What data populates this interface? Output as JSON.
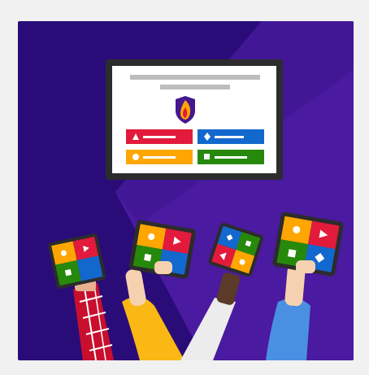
{
  "colors": {
    "background_dark": "#2a0c78",
    "background_light": "#4a1aa0",
    "frame": "#f1f1f1",
    "monitor_bezel": "#2c2c2c",
    "screen": "#ffffff",
    "red": "#e21b3c",
    "blue": "#1368ce",
    "yellow": "#ffa602",
    "green": "#26890c",
    "flame_outer": "#ffa602",
    "flame_inner": "#e21b3c",
    "shield": "#46178f"
  },
  "scene": {
    "monitor": {
      "answer_tiles": [
        {
          "color": "red",
          "shape": "triangle"
        },
        {
          "color": "blue",
          "shape": "diamond"
        },
        {
          "color": "yellow",
          "shape": "circle"
        },
        {
          "color": "green",
          "shape": "square"
        }
      ]
    },
    "hands": [
      {
        "sleeve": "red-plaid",
        "device": "tablet"
      },
      {
        "sleeve": "yellow",
        "device": "tablet"
      },
      {
        "sleeve": "white",
        "device": "phone"
      },
      {
        "sleeve": "blue",
        "device": "tablet"
      }
    ]
  }
}
